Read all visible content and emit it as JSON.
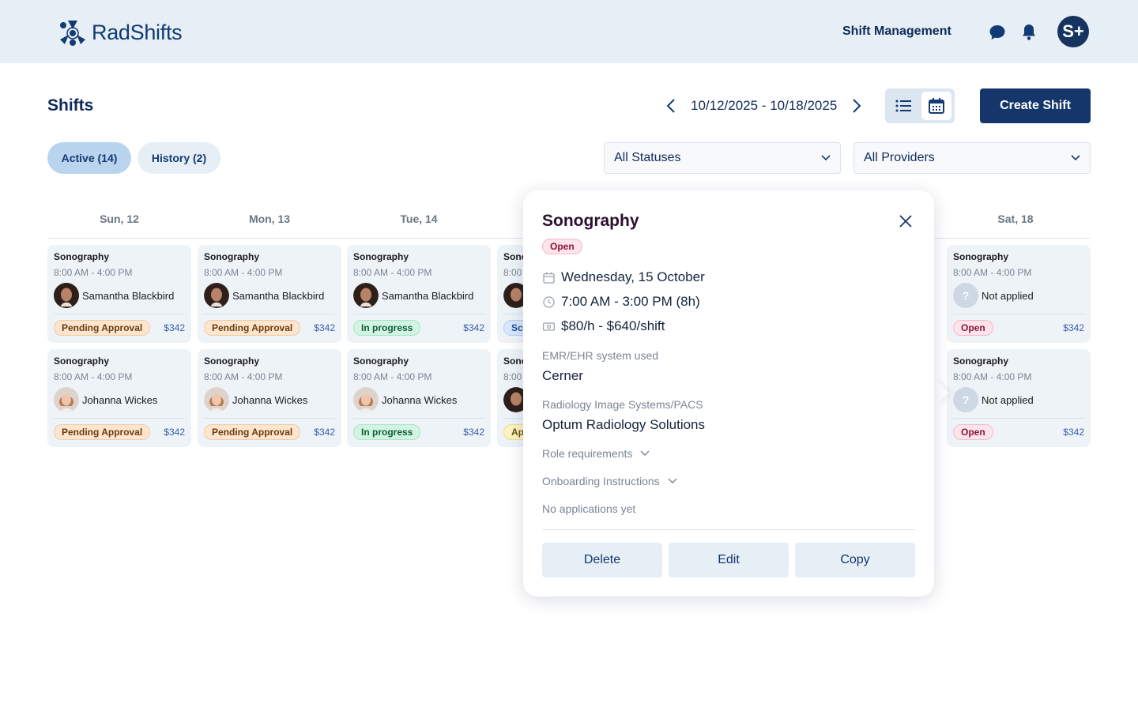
{
  "app": {
    "name": "RadShifts",
    "nav_link": "Shift Management",
    "avatar_initials": "S+"
  },
  "page": {
    "title": "Shifts",
    "date_range": "10/12/2025 - 10/18/2025",
    "create_button": "Create Shift"
  },
  "tabs": [
    {
      "label": "Active (14)",
      "active": true
    },
    {
      "label": "History (2)",
      "active": false
    }
  ],
  "filters": {
    "status": "All Statuses",
    "provider": "All Providers"
  },
  "days": [
    "Sun, 12",
    "Mon, 13",
    "Tue, 14",
    "",
    "",
    "",
    "Sat, 18"
  ],
  "columns": [
    {
      "cards": [
        {
          "title": "Sonography",
          "time": "8:00 AM - 4:00 PM",
          "name": "Samantha Blackbird",
          "status": "Pending Approval",
          "price": "$342"
        },
        {
          "title": "Sonography",
          "time": "8:00 AM - 4:00 PM",
          "name": "Johanna Wickes",
          "status": "Pending Approval",
          "price": "$342"
        }
      ]
    },
    {
      "cards": [
        {
          "title": "Sonography",
          "time": "8:00 AM - 4:00 PM",
          "name": "Samantha Blackbird",
          "status": "Pending Approval",
          "price": "$342"
        },
        {
          "title": "Sonography",
          "time": "8:00 AM - 4:00 PM",
          "name": "Johanna Wickes",
          "status": "Pending Approval",
          "price": "$342"
        }
      ]
    },
    {
      "cards": [
        {
          "title": "Sonography",
          "time": "8:00 AM - 4:00 PM",
          "name": "Samantha Blackbird",
          "status": "In progress",
          "price": "$342"
        },
        {
          "title": "Sonography",
          "time": "8:00 AM - 4:00 PM",
          "name": "Johanna Wickes",
          "status": "In progress",
          "price": "$342"
        }
      ]
    },
    {
      "cards": [
        {
          "title": "Sono",
          "time": "8:00",
          "name": "",
          "status": "Sc",
          "price": ""
        },
        {
          "title": "Sono",
          "time": "8:00",
          "name": "",
          "status": "Ap",
          "price": ""
        }
      ]
    },
    {
      "cards": [
        {
          "title": "Sonography",
          "time": "8:00 AM - 4:00 PM",
          "name": "Not applied",
          "status": "Open",
          "price": "$342"
        },
        {
          "title": "Sonography",
          "time": "8:00 AM - 4:00 PM",
          "name": "Not applied",
          "status": "Open",
          "price": "$342"
        }
      ]
    }
  ],
  "popover": {
    "title": "Sonography",
    "status": "Open",
    "date": "Wednesday, 15 October",
    "time": "7:00 AM - 3:00 PM (8h)",
    "rate": "$80/h - $640/shift",
    "emr_label": "EMR/EHR system used",
    "emr_value": "Cerner",
    "pacs_label": "Radiology Image Systems/PACS",
    "pacs_value": "Optum Radiology Solutions",
    "role_requirements": "Role requirements",
    "onboarding": "Onboarding Instructions",
    "applications": "No applications yet",
    "delete": "Delete",
    "edit": "Edit",
    "copy": "Copy"
  },
  "colors": {
    "brand": "#14366b",
    "topbar": "#e6eef6",
    "card": "#eef3f8"
  }
}
